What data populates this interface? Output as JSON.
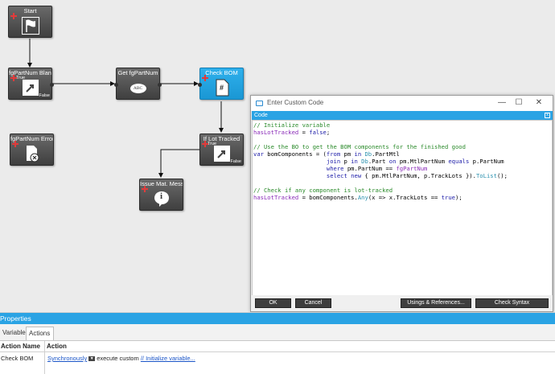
{
  "workflow": {
    "nodes": [
      {
        "title": "Start",
        "icon": "flag-icon"
      },
      {
        "title": "fgPartNum Blank",
        "true_label": "True",
        "false_label": "False",
        "icon": "arrow-icon"
      },
      {
        "title": "Get fgPartNum",
        "icon": "abc-icon",
        "icon_text": "ABC"
      },
      {
        "title": "Check BOM",
        "icon": "code-file-icon",
        "icon_text": "#"
      },
      {
        "title": "fgPartNum Error",
        "icon": "error-doc-icon"
      },
      {
        "title": "If Lot Tracked",
        "true_label": "True",
        "false_label": "False",
        "icon": "arrow-icon"
      },
      {
        "title": "Issue Mat. Messag",
        "icon": "info-icon",
        "icon_text": "i"
      }
    ]
  },
  "dialog": {
    "title": "Enter Custom Code",
    "section": "Code",
    "code": [
      "// Initialize variable",
      "hasLotTracked = false;",
      "",
      "// Use the BO to get the BOM components for the finished good",
      "var bomComponents = (from pm in Db.PartMtl",
      "                     join p in Db.Part on pm.MtlPartNum equals p.PartNum",
      "                     where pm.PartNum == fgPartNum",
      "                     select new { pm.MtlPartNum, p.TrackLots }).ToList();",
      "",
      "// Check if any component is lot-tracked",
      "hasLotTracked = bomComponents.Any(x => x.TrackLots == true);"
    ],
    "buttons": {
      "ok": "OK",
      "cancel": "Cancel",
      "usings": "Usings & References...",
      "check_syntax": "Check Syntax"
    }
  },
  "properties": {
    "header": "Properties",
    "tabs": [
      "Variables",
      "Actions"
    ],
    "selected_tab": "Actions",
    "columns": [
      "Action Name",
      "Action"
    ],
    "row": {
      "name": "Check BOM",
      "mode": "Synchronously",
      "middle": "execute custom",
      "code_link": "// Initialize variable..."
    }
  },
  "colors": {
    "accent": "#2aa3e4",
    "node": "#4f4f4f",
    "active_node": "#1fa3e4"
  }
}
